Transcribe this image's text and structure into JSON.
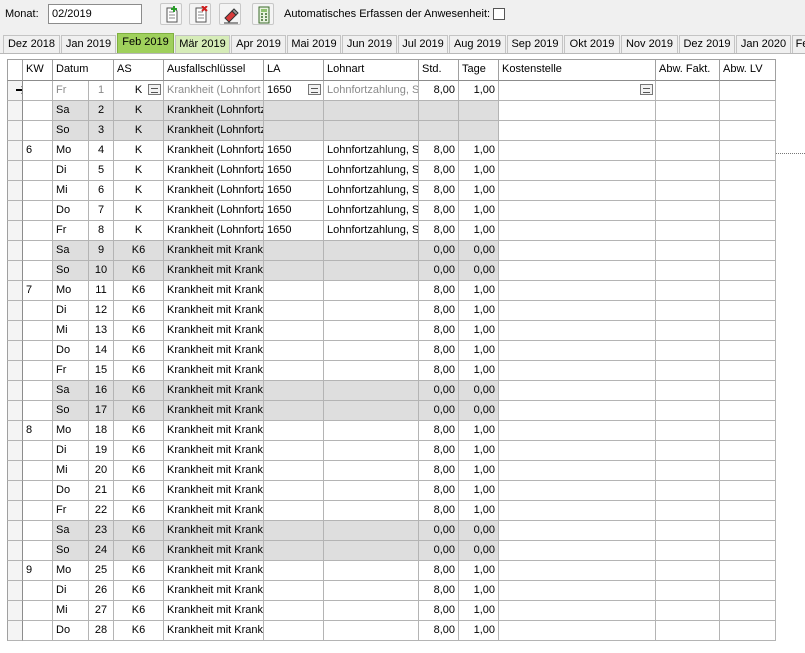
{
  "toolbar": {
    "monat_label": "Monat:",
    "monat_value": "02/2019",
    "auto_label": "Automatisches Erfassen der Anwesenheit:",
    "auto_checked": false
  },
  "tabs": [
    "Dez 2018",
    "Jan 2019",
    "Feb 2019",
    "Mär 2019",
    "Apr 2019",
    "Mai 2019",
    "Jun 2019",
    "Jul 2019",
    "Aug 2019",
    "Sep 2019",
    "Okt 2019",
    "Nov 2019",
    "Dez 2019",
    "Jan 2020",
    "Fe"
  ],
  "selected_tab": "Feb 2019",
  "columns": [
    "KW",
    "Datum",
    "",
    "AS",
    "Ausfallschlüssel",
    "LA",
    "Lohnart",
    "Std.",
    "Tage",
    "Kostenstelle",
    "Abw. Fakt.",
    "Abw. LV"
  ],
  "rows": [
    {
      "kw": "",
      "wd": "Fr",
      "day": "1",
      "as": "K",
      "aus": "Krankheit (Lohnfort",
      "la": "1650",
      "lohn": "Lohnfortzahlung, S",
      "std": "8,00",
      "tage": "1,00",
      "current": true,
      "weekend": false
    },
    {
      "kw": "",
      "wd": "Sa",
      "day": "2",
      "as": "K",
      "aus": "Krankheit (Lohnfortz",
      "la": "",
      "lohn": "",
      "std": "",
      "tage": "",
      "weekend": true
    },
    {
      "kw": "",
      "wd": "So",
      "day": "3",
      "as": "K",
      "aus": "Krankheit (Lohnfortz",
      "la": "",
      "lohn": "",
      "std": "",
      "tage": "",
      "weekend": true
    },
    {
      "kw": "6",
      "wd": "Mo",
      "day": "4",
      "as": "K",
      "aus": "Krankheit (Lohnfortz",
      "la": "1650",
      "lohn": "Lohnfortzahlung, St",
      "std": "8,00",
      "tage": "1,00",
      "weekend": false
    },
    {
      "kw": "",
      "wd": "Di",
      "day": "5",
      "as": "K",
      "aus": "Krankheit (Lohnfortz",
      "la": "1650",
      "lohn": "Lohnfortzahlung, St",
      "std": "8,00",
      "tage": "1,00",
      "weekend": false
    },
    {
      "kw": "",
      "wd": "Mi",
      "day": "6",
      "as": "K",
      "aus": "Krankheit (Lohnfortz",
      "la": "1650",
      "lohn": "Lohnfortzahlung, St",
      "std": "8,00",
      "tage": "1,00",
      "weekend": false
    },
    {
      "kw": "",
      "wd": "Do",
      "day": "7",
      "as": "K",
      "aus": "Krankheit (Lohnfortz",
      "la": "1650",
      "lohn": "Lohnfortzahlung, St",
      "std": "8,00",
      "tage": "1,00",
      "weekend": false
    },
    {
      "kw": "",
      "wd": "Fr",
      "day": "8",
      "as": "K",
      "aus": "Krankheit (Lohnfortz",
      "la": "1650",
      "lohn": "Lohnfortzahlung, St",
      "std": "8,00",
      "tage": "1,00",
      "weekend": false
    },
    {
      "kw": "",
      "wd": "Sa",
      "day": "9",
      "as": "K6",
      "aus": "Krankheit mit Kranke",
      "la": "",
      "lohn": "",
      "std": "0,00",
      "tage": "0,00",
      "weekend": true
    },
    {
      "kw": "",
      "wd": "So",
      "day": "10",
      "as": "K6",
      "aus": "Krankheit mit Kranke",
      "la": "",
      "lohn": "",
      "std": "0,00",
      "tage": "0,00",
      "weekend": true
    },
    {
      "kw": "7",
      "wd": "Mo",
      "day": "11",
      "as": "K6",
      "aus": "Krankheit mit Kranke",
      "la": "",
      "lohn": "",
      "std": "8,00",
      "tage": "1,00",
      "weekend": false
    },
    {
      "kw": "",
      "wd": "Di",
      "day": "12",
      "as": "K6",
      "aus": "Krankheit mit Kranke",
      "la": "",
      "lohn": "",
      "std": "8,00",
      "tage": "1,00",
      "weekend": false
    },
    {
      "kw": "",
      "wd": "Mi",
      "day": "13",
      "as": "K6",
      "aus": "Krankheit mit Kranke",
      "la": "",
      "lohn": "",
      "std": "8,00",
      "tage": "1,00",
      "weekend": false
    },
    {
      "kw": "",
      "wd": "Do",
      "day": "14",
      "as": "K6",
      "aus": "Krankheit mit Kranke",
      "la": "",
      "lohn": "",
      "std": "8,00",
      "tage": "1,00",
      "weekend": false
    },
    {
      "kw": "",
      "wd": "Fr",
      "day": "15",
      "as": "K6",
      "aus": "Krankheit mit Kranke",
      "la": "",
      "lohn": "",
      "std": "8,00",
      "tage": "1,00",
      "weekend": false
    },
    {
      "kw": "",
      "wd": "Sa",
      "day": "16",
      "as": "K6",
      "aus": "Krankheit mit Kranke",
      "la": "",
      "lohn": "",
      "std": "0,00",
      "tage": "0,00",
      "weekend": true
    },
    {
      "kw": "",
      "wd": "So",
      "day": "17",
      "as": "K6",
      "aus": "Krankheit mit Kranke",
      "la": "",
      "lohn": "",
      "std": "0,00",
      "tage": "0,00",
      "weekend": true
    },
    {
      "kw": "8",
      "wd": "Mo",
      "day": "18",
      "as": "K6",
      "aus": "Krankheit mit Kranke",
      "la": "",
      "lohn": "",
      "std": "8,00",
      "tage": "1,00",
      "weekend": false
    },
    {
      "kw": "",
      "wd": "Di",
      "day": "19",
      "as": "K6",
      "aus": "Krankheit mit Kranke",
      "la": "",
      "lohn": "",
      "std": "8,00",
      "tage": "1,00",
      "weekend": false
    },
    {
      "kw": "",
      "wd": "Mi",
      "day": "20",
      "as": "K6",
      "aus": "Krankheit mit Kranke",
      "la": "",
      "lohn": "",
      "std": "8,00",
      "tage": "1,00",
      "weekend": false
    },
    {
      "kw": "",
      "wd": "Do",
      "day": "21",
      "as": "K6",
      "aus": "Krankheit mit Kranke",
      "la": "",
      "lohn": "",
      "std": "8,00",
      "tage": "1,00",
      "weekend": false
    },
    {
      "kw": "",
      "wd": "Fr",
      "day": "22",
      "as": "K6",
      "aus": "Krankheit mit Kranke",
      "la": "",
      "lohn": "",
      "std": "8,00",
      "tage": "1,00",
      "weekend": false
    },
    {
      "kw": "",
      "wd": "Sa",
      "day": "23",
      "as": "K6",
      "aus": "Krankheit mit Kranke",
      "la": "",
      "lohn": "",
      "std": "0,00",
      "tage": "0,00",
      "weekend": true
    },
    {
      "kw": "",
      "wd": "So",
      "day": "24",
      "as": "K6",
      "aus": "Krankheit mit Kranke",
      "la": "",
      "lohn": "",
      "std": "0,00",
      "tage": "0,00",
      "weekend": true
    },
    {
      "kw": "9",
      "wd": "Mo",
      "day": "25",
      "as": "K6",
      "aus": "Krankheit mit Kranke",
      "la": "",
      "lohn": "",
      "std": "8,00",
      "tage": "1,00",
      "weekend": false
    },
    {
      "kw": "",
      "wd": "Di",
      "day": "26",
      "as": "K6",
      "aus": "Krankheit mit Kranke",
      "la": "",
      "lohn": "",
      "std": "8,00",
      "tage": "1,00",
      "weekend": false
    },
    {
      "kw": "",
      "wd": "Mi",
      "day": "27",
      "as": "K6",
      "aus": "Krankheit mit Kranke",
      "la": "",
      "lohn": "",
      "std": "8,00",
      "tage": "1,00",
      "weekend": false
    },
    {
      "kw": "",
      "wd": "Do",
      "day": "28",
      "as": "K6",
      "aus": "Krankheit mit Kranke",
      "la": "",
      "lohn": "",
      "std": "8,00",
      "tage": "1,00",
      "weekend": false
    }
  ],
  "icons": {
    "new": "add-document-icon",
    "delete": "delete-document-icon",
    "edit": "eraser-icon",
    "calc": "calculator-icon",
    "current_row": "row-pointer-arrow-icon"
  },
  "colors": {
    "selected_tab": "#9fd05c",
    "weekend_row": "#dedede"
  }
}
